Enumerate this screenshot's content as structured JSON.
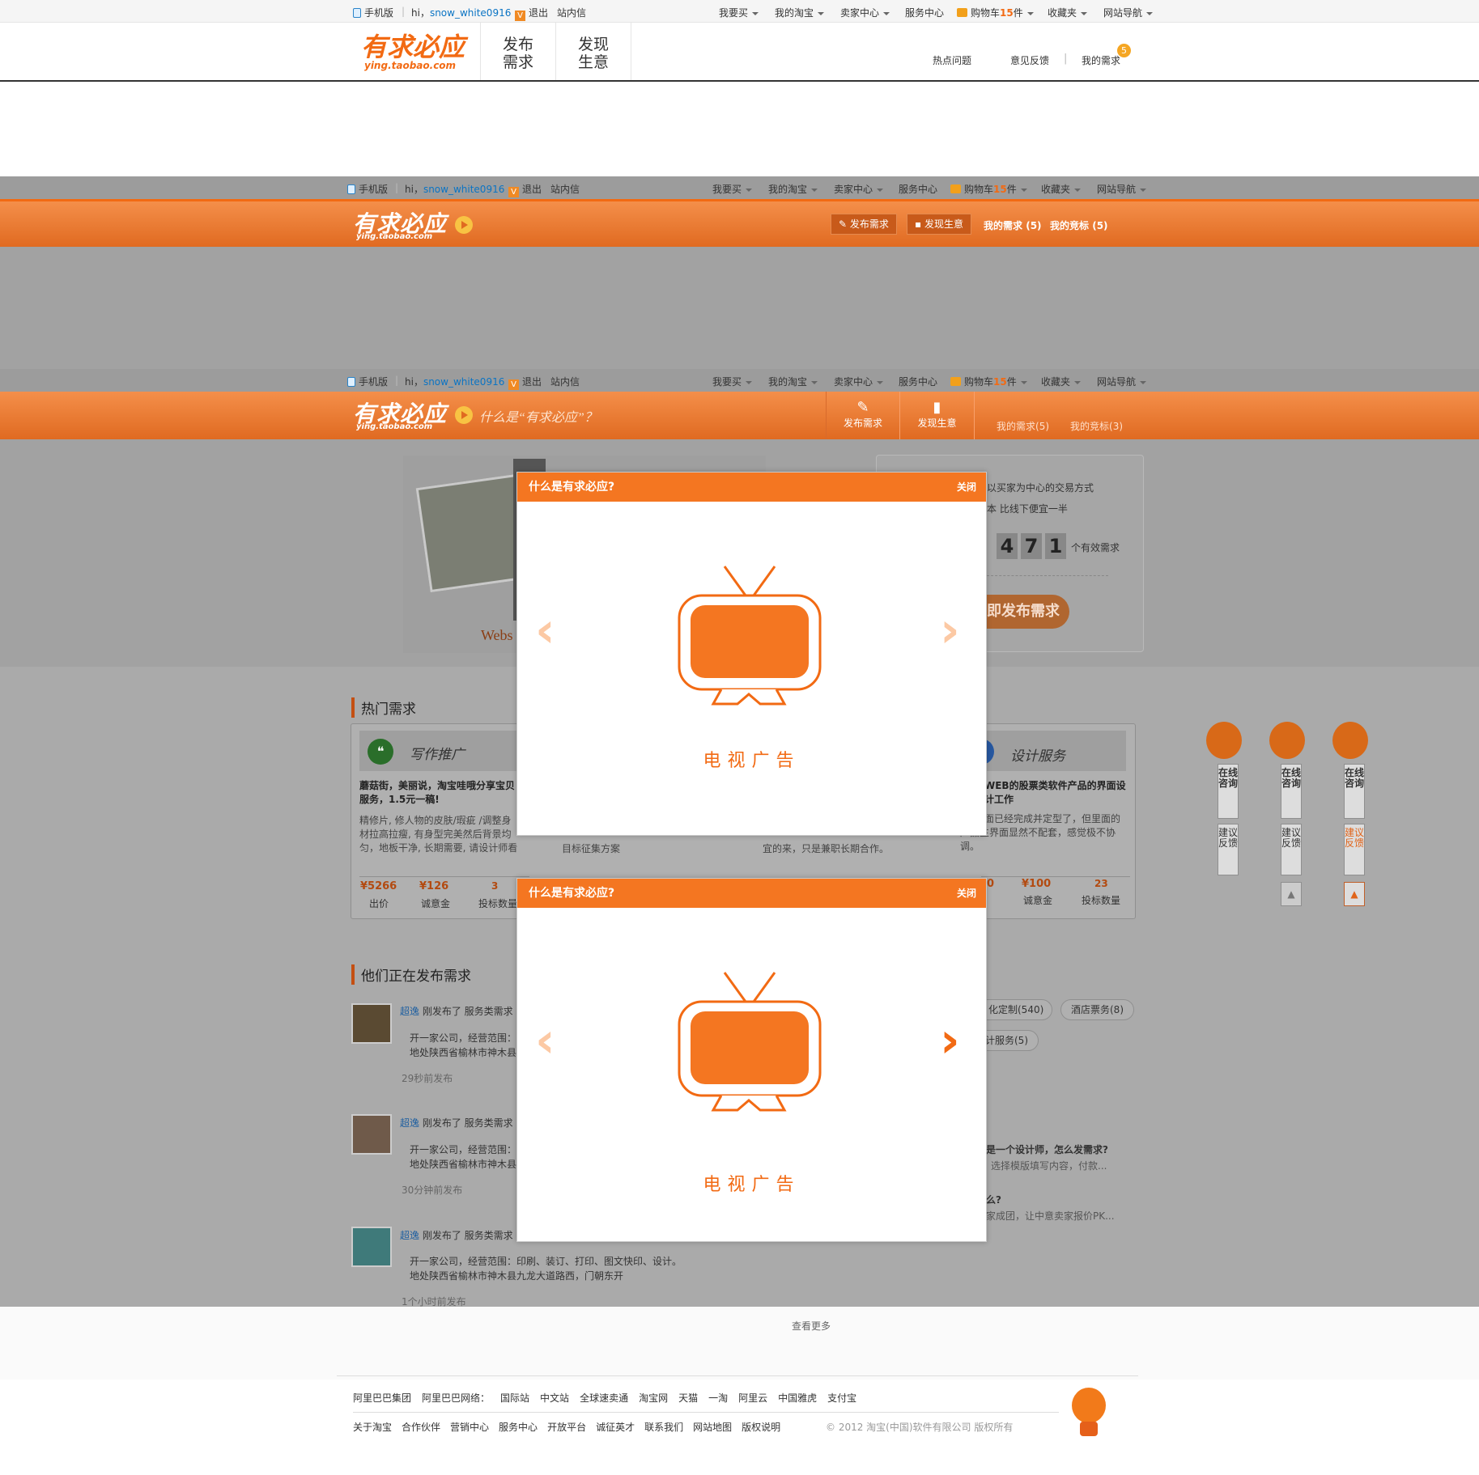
{
  "topbar": {
    "mobile": "手机版",
    "hi": "hi，",
    "username": "snow_white0916",
    "logout": "退出",
    "messages": "站内信",
    "buy": "我要买",
    "my_taobao": "我的淘宝",
    "seller": "卖家中心",
    "service": "服务中心",
    "cart_label": "购物车",
    "cart_count": "15",
    "cart_unit": "件",
    "favorites": "收藏夹",
    "site_nav": "网站导航"
  },
  "header1": {
    "logo": "有求必应",
    "logo_url": "ying.taobao.com",
    "nav_publish_1": "发布",
    "nav_publish_2": "需求",
    "nav_discover_1": "发现",
    "nav_discover_2": "生意",
    "hot_questions": "热点问题",
    "feedback": "意见反馈",
    "my_demand": "我的需求",
    "badge": "5"
  },
  "header2": {
    "logo": "有求必应",
    "logo_url": "ying.taobao.com",
    "publish": "发布需求",
    "discover": "发现生意",
    "my_demand": "我的需求",
    "my_demand_count": "(5)",
    "my_bid": "我的竞标",
    "my_bid_count": "(5)"
  },
  "header3": {
    "logo": "有求必应",
    "logo_url": "ying.taobao.com",
    "slogan": "什么是“有求必应”？",
    "publish": "发布需求",
    "discover": "发现生意",
    "my_demand": "我的需求",
    "my_demand_count": "(5)",
    "my_bid": "我的竞标",
    "my_bid_count": "(3)"
  },
  "hero": {
    "line1": "以买家为中心的交易方式",
    "line2": "本  比线下便宜一半",
    "digits": [
      "4",
      "7",
      "1"
    ],
    "count_suffix": "个有效需求",
    "cta": "即发布需求",
    "web_text": "Webs"
  },
  "hot": {
    "title": "热门需求",
    "card1_cat": "写作推广",
    "card1_title": "蘑菇街，美丽说，淘宝哇哦分享宝贝服务，1.5元一稿!",
    "card1_desc": "精修片, 修人物的皮肤/瑕疵  /调整身材拉高拉瘦, 有身型完美然后背景均匀，地板干净, 长期需要, 请设计师看看~",
    "card1_price": "¥5266",
    "card1_price_label": "出价",
    "card1_deposit": "¥126",
    "card1_deposit_label": "诚意金",
    "card1_bids": "3",
    "card1_bids_label": "投标数量",
    "card2_desc": "目标征集方案",
    "card3_desc": "宜的来，只是兼职长期合作。",
    "card4_cat": "设计服务",
    "card4_title": "WEB的股票类软件产品的界面设计工作",
    "card4_desc": "面已经完成并定型了，但里面的产品主界面显然不配套，感觉极不协调。",
    "card4_price": "0",
    "card4_deposit": "¥100",
    "card4_deposit_label": "诚意金",
    "card4_bids": "23",
    "card4_bids_label": "投标数量"
  },
  "feed": {
    "title": "他们正在发布需求",
    "items": [
      {
        "user": "超逸",
        "action": "刚发布了 服务类需求",
        "line1": "开一家公司，经营范围：",
        "line2": "地处陕西省榆林市神木县",
        "time": "29秒前发布"
      },
      {
        "user": "超逸",
        "action": "刚发布了 服务类需求",
        "line1": "开一家公司，经营范围：",
        "line2": "地处陕西省榆林市神木县",
        "time": "30分钟前发布"
      },
      {
        "user": "超逸",
        "action": "刚发布了 服务类需求",
        "line1": "开一家公司，经营范围：印刷、装订、打印、图文快印、设计。",
        "line2": "地处陕西省榆林市神木县九龙大道路西，门朝东开",
        "time": "1个小时前发布"
      }
    ],
    "more": "查看更多"
  },
  "tags": {
    "t1": "化定制(540)",
    "t2": "酒店票务(8)",
    "t3": "计服务(5)"
  },
  "faq": {
    "q1": "是一个设计师，怎么发需求?",
    "a1": "选择模版填写内容，付款...",
    "q2": "么?",
    "a2": "家成团，让中意卖家报价PK..."
  },
  "modal": {
    "title": "什么是有求必应?",
    "close": "关闭",
    "caption": "电视广告",
    "prev": "‹",
    "next": "›"
  },
  "float": {
    "consult": "在线咨询",
    "suggest": "建议反馈"
  },
  "footer": {
    "row1": [
      "阿里巴巴集团",
      "阿里巴巴网络：",
      "国际站",
      "中文站",
      "全球速卖通",
      "淘宝网",
      "天猫",
      "一淘",
      "阿里云",
      "中国雅虎",
      "支付宝"
    ],
    "row2": [
      "关于淘宝",
      "合作伙伴",
      "营销中心",
      "服务中心",
      "开放平台",
      "诚征英才",
      "联系我们",
      "网站地图",
      "版权说明"
    ],
    "copyright": "© 2012 淘宝(中国)软件有限公司 版权所有"
  },
  "colors": {
    "accent": "#f47621",
    "overlay": "#a2a2a2"
  }
}
